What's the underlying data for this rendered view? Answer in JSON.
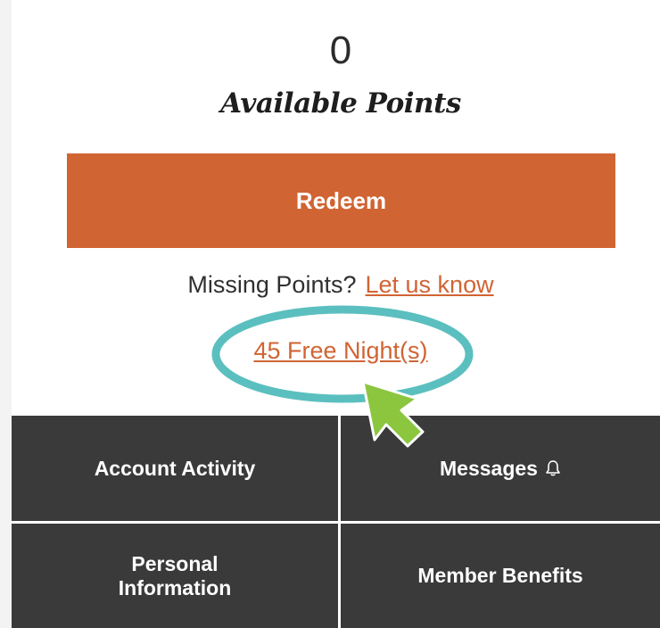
{
  "points": {
    "value": "0",
    "label": "Available Points"
  },
  "redeem": {
    "label": "Redeem"
  },
  "missing_points": {
    "prompt": "Missing Points?",
    "link": "Let us know"
  },
  "free_nights": {
    "label": "45 Free Night(s)"
  },
  "nav": {
    "account_activity": "Account Activity",
    "messages": "Messages",
    "personal_information": "Personal Information",
    "member_benefits": "Member Benefits"
  },
  "colors": {
    "accent": "#d06433",
    "nav_bg": "#3b3a3a",
    "highlight_ring": "#5bbfbf",
    "pointer_arrow": "#8cc63f"
  },
  "icons": {
    "messages_icon": "bell-icon",
    "annotation_arrow": "arrow-pointer-icon"
  }
}
